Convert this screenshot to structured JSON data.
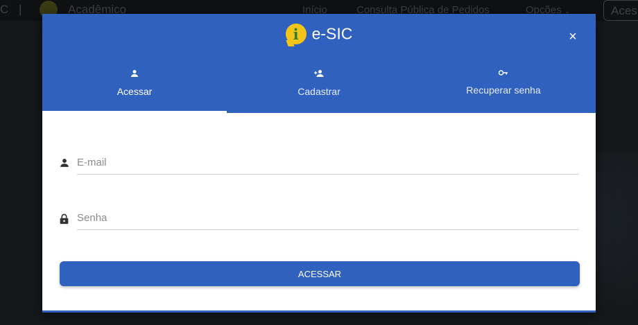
{
  "background": {
    "brand_fragment": "C",
    "separator": "|",
    "app_name": "Acadêmico",
    "nav": [
      "Início",
      "Consulta Pública de Pedidos",
      "Opções"
    ],
    "access_button": "Aces"
  },
  "modal": {
    "logo_letter": "i",
    "title": "e-SIC",
    "close_label": "×",
    "tabs": [
      {
        "label": "Acessar",
        "icon": "person-icon",
        "active": true
      },
      {
        "label": "Cadastrar",
        "icon": "person-add-icon",
        "active": false
      },
      {
        "label": "Recuperar senha",
        "icon": "key-icon",
        "active": false
      }
    ],
    "email": {
      "value": "",
      "placeholder": "E-mail",
      "icon": "person-icon"
    },
    "password": {
      "value": "",
      "placeholder": "Senha",
      "icon": "lock-icon"
    },
    "submit_label": "ACESSAR"
  },
  "colors": {
    "primary": "#3161bf",
    "backdrop": "#15191c",
    "logo_yellow": "#f2c518"
  }
}
